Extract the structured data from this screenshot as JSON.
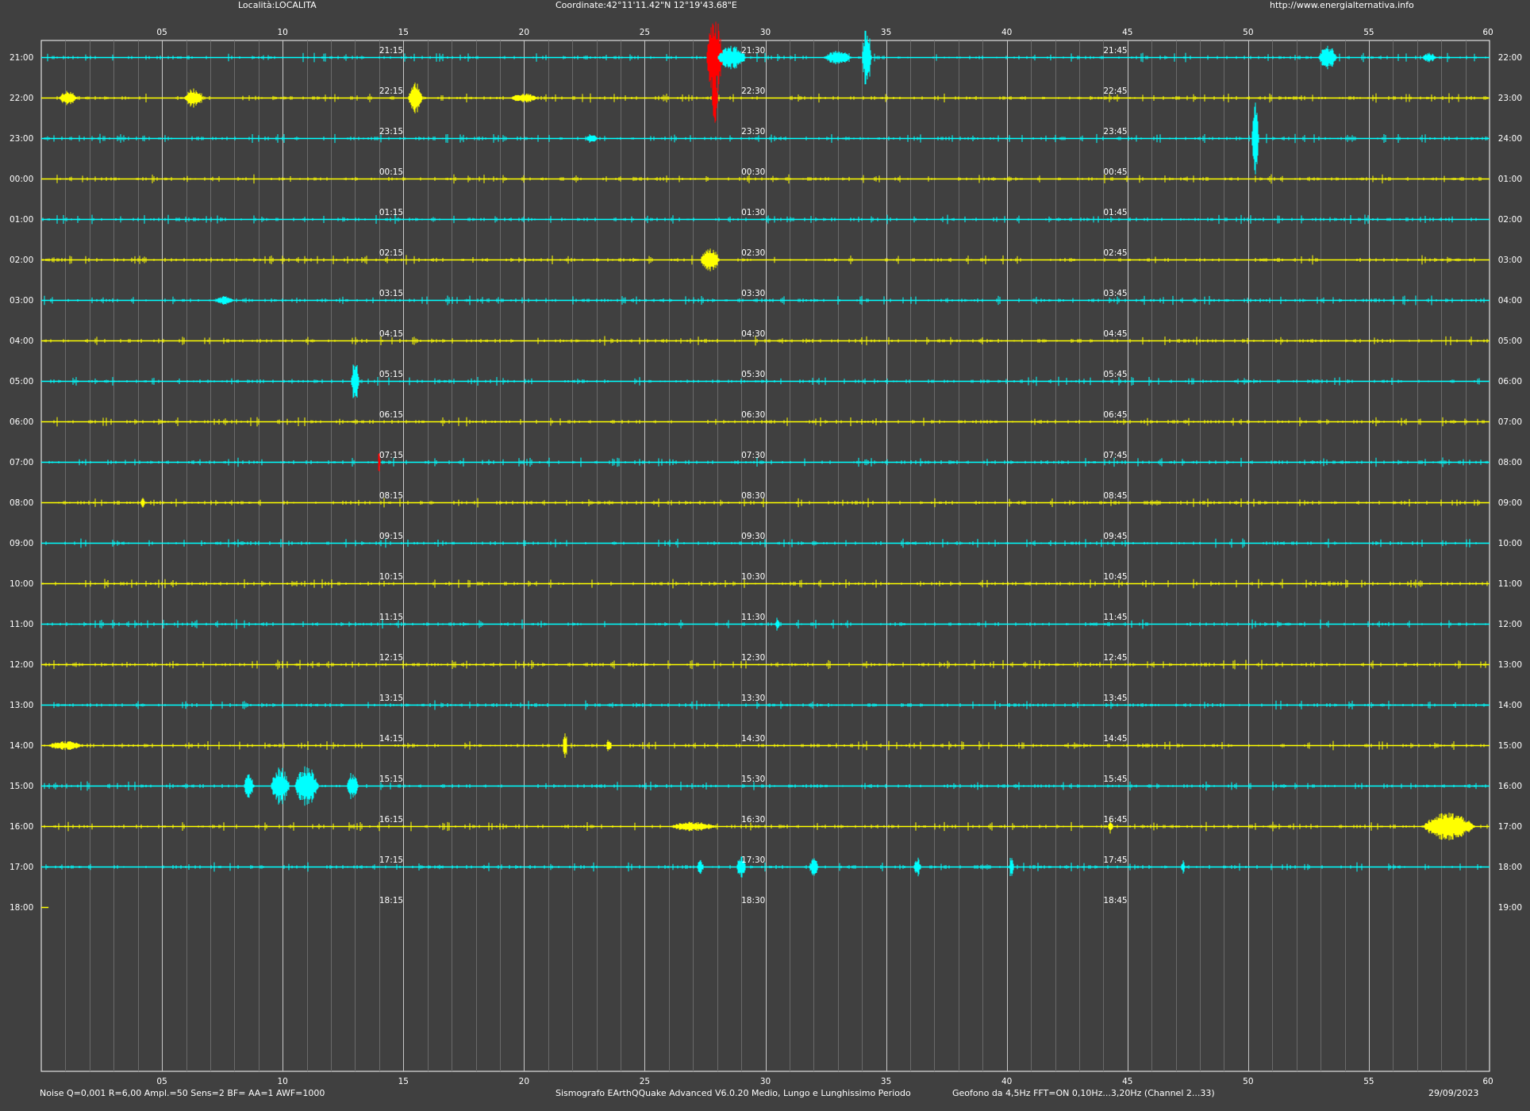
{
  "header": {
    "location": "Località:LOCALITA",
    "coordinates": "Coordinate:42°11'11.42\"N  12°19'43.68\"E",
    "website": "http://www.energialternativa.info"
  },
  "footer": {
    "settings": "Noise Q=0,001 R=6,00 Ampl.=50 Sens=2 BF= AA=1 AWF=1000",
    "software": "Sismografo  EArthQQuake Advanced V6.0.20  Medio, Lungo e Lunghissimo Periodo",
    "sensor": "Geofono da 4,5Hz FFT=ON 0,10Hz...3,20Hz      (Channel 2...33)",
    "date": "29/09/2023"
  },
  "colors": {
    "background": "#404040",
    "frame": "#ffffff",
    "grid_major": "#c8c8c8",
    "grid_minor": "#6a6a6a",
    "trace_a": "#00ffff",
    "trace_b": "#ffff00",
    "clip": "#ff0000",
    "text": "#ffffff"
  },
  "chart_data": {
    "type": "line",
    "title": "",
    "x_unit": "minutes",
    "xlim": [
      0,
      60
    ],
    "x_ticks": [
      "05",
      "10",
      "15",
      "20",
      "25",
      "30",
      "35",
      "40",
      "45",
      "50",
      "55",
      "60"
    ],
    "left_labels": [
      "21:00",
      "22:00",
      "23:00",
      "00:00",
      "01:00",
      "02:00",
      "03:00",
      "04:00",
      "05:00",
      "06:00",
      "07:00",
      "08:00",
      "09:00",
      "10:00",
      "11:00",
      "12:00",
      "13:00",
      "14:00",
      "15:00",
      "16:00",
      "17:00",
      "18:00"
    ],
    "right_labels": [
      "22:00",
      "23:00",
      "24:00",
      "01:00",
      "02:00",
      "03:00",
      "04:00",
      "05:00",
      "06:00",
      "07:00",
      "08:00",
      "09:00",
      "10:00",
      "11:00",
      "12:00",
      "13:00",
      "14:00",
      "15:00",
      "16:00",
      "17:00",
      "18:00",
      "19:00"
    ],
    "quarter_labels": [
      [
        "21:15",
        "21:30",
        "21:45"
      ],
      [
        "22:15",
        "22:30",
        "22:45"
      ],
      [
        "23:15",
        "23:30",
        "23:45"
      ],
      [
        "00:15",
        "00:30",
        "00:45"
      ],
      [
        "01:15",
        "01:30",
        "01:45"
      ],
      [
        "02:15",
        "02:30",
        "02:45"
      ],
      [
        "03:15",
        "03:30",
        "03:45"
      ],
      [
        "04:15",
        "04:30",
        "04:45"
      ],
      [
        "05:15",
        "05:30",
        "05:45"
      ],
      [
        "06:15",
        "06:30",
        "06:45"
      ],
      [
        "07:15",
        "07:30",
        "07:45"
      ],
      [
        "08:15",
        "08:30",
        "08:45"
      ],
      [
        "09:15",
        "09:30",
        "09:45"
      ],
      [
        "10:15",
        "10:30",
        "10:45"
      ],
      [
        "11:15",
        "11:30",
        "11:45"
      ],
      [
        "12:15",
        "12:30",
        "12:45"
      ],
      [
        "13:15",
        "13:30",
        "13:45"
      ],
      [
        "14:15",
        "14:30",
        "14:45"
      ],
      [
        "15:15",
        "15:30",
        "15:45"
      ],
      [
        "16:15",
        "16:30",
        "16:45"
      ],
      [
        "17:15",
        "17:30",
        "17:45"
      ],
      [
        "18:15",
        "18:30",
        "18:45"
      ]
    ],
    "quarter_minutes": [
      14,
      29,
      44
    ],
    "trace_end_minute": {
      "row": 21,
      "minute": 0.3
    },
    "events": [
      {
        "row": 0,
        "minute": 27.9,
        "amp": 1.7,
        "width": 0.7,
        "clip": true
      },
      {
        "row": 0,
        "minute": 28.6,
        "amp": 0.5,
        "width": 1.2
      },
      {
        "row": 0,
        "minute": 34.2,
        "amp": 1.3,
        "width": 0.4
      },
      {
        "row": 0,
        "minute": 33.0,
        "amp": 0.3,
        "width": 1.2
      },
      {
        "row": 0,
        "minute": 53.3,
        "amp": 0.5,
        "width": 0.8
      },
      {
        "row": 0,
        "minute": 57.5,
        "amp": 0.2,
        "width": 0.6
      },
      {
        "row": 1,
        "minute": 1.1,
        "amp": 0.3,
        "width": 0.8
      },
      {
        "row": 1,
        "minute": 6.3,
        "amp": 0.4,
        "width": 0.8
      },
      {
        "row": 1,
        "minute": 15.5,
        "amp": 0.7,
        "width": 0.6
      },
      {
        "row": 1,
        "minute": 27.9,
        "amp": 1.2,
        "width": 0.25,
        "clip": true
      },
      {
        "row": 1,
        "minute": 20.0,
        "amp": 0.2,
        "width": 1.2
      },
      {
        "row": 2,
        "minute": 50.3,
        "amp": 1.5,
        "width": 0.3
      },
      {
        "row": 2,
        "minute": 50.3,
        "amp": 2.2,
        "width": 0.1
      },
      {
        "row": 2,
        "minute": 22.8,
        "amp": 0.2,
        "width": 0.5
      },
      {
        "row": 5,
        "minute": 27.7,
        "amp": 0.6,
        "width": 0.8
      },
      {
        "row": 6,
        "minute": 7.6,
        "amp": 0.2,
        "width": 0.8
      },
      {
        "row": 8,
        "minute": 13.0,
        "amp": 0.9,
        "width": 0.35
      },
      {
        "row": 10,
        "minute": 14.0,
        "amp": 0.5,
        "width": 0.1,
        "clip": true
      },
      {
        "row": 11,
        "minute": 4.2,
        "amp": 0.2,
        "width": 0.2
      },
      {
        "row": 14,
        "minute": 30.5,
        "amp": 0.3,
        "width": 0.2
      },
      {
        "row": 17,
        "minute": 21.7,
        "amp": 0.7,
        "width": 0.2
      },
      {
        "row": 17,
        "minute": 23.5,
        "amp": 0.3,
        "width": 0.2
      },
      {
        "row": 17,
        "minute": 1.0,
        "amp": 0.2,
        "width": 1.5
      },
      {
        "row": 18,
        "minute": 8.6,
        "amp": 0.6,
        "width": 0.4
      },
      {
        "row": 18,
        "minute": 9.9,
        "amp": 0.8,
        "width": 0.8
      },
      {
        "row": 18,
        "minute": 11.0,
        "amp": 0.9,
        "width": 1.0
      },
      {
        "row": 18,
        "minute": 12.9,
        "amp": 0.6,
        "width": 0.5
      },
      {
        "row": 19,
        "minute": 58.3,
        "amp": 0.6,
        "width": 2.2
      },
      {
        "row": 19,
        "minute": 44.3,
        "amp": 0.3,
        "width": 0.2
      },
      {
        "row": 19,
        "minute": 27.0,
        "amp": 0.2,
        "width": 2.0
      },
      {
        "row": 20,
        "minute": 40.2,
        "amp": 0.6,
        "width": 0.2
      },
      {
        "row": 20,
        "minute": 29.0,
        "amp": 0.5,
        "width": 0.4
      },
      {
        "row": 20,
        "minute": 32.0,
        "amp": 0.4,
        "width": 0.4
      },
      {
        "row": 20,
        "minute": 36.3,
        "amp": 0.4,
        "width": 0.3
      },
      {
        "row": 20,
        "minute": 27.3,
        "amp": 0.3,
        "width": 0.3
      },
      {
        "row": 20,
        "minute": 47.3,
        "amp": 0.3,
        "width": 0.2
      }
    ]
  }
}
